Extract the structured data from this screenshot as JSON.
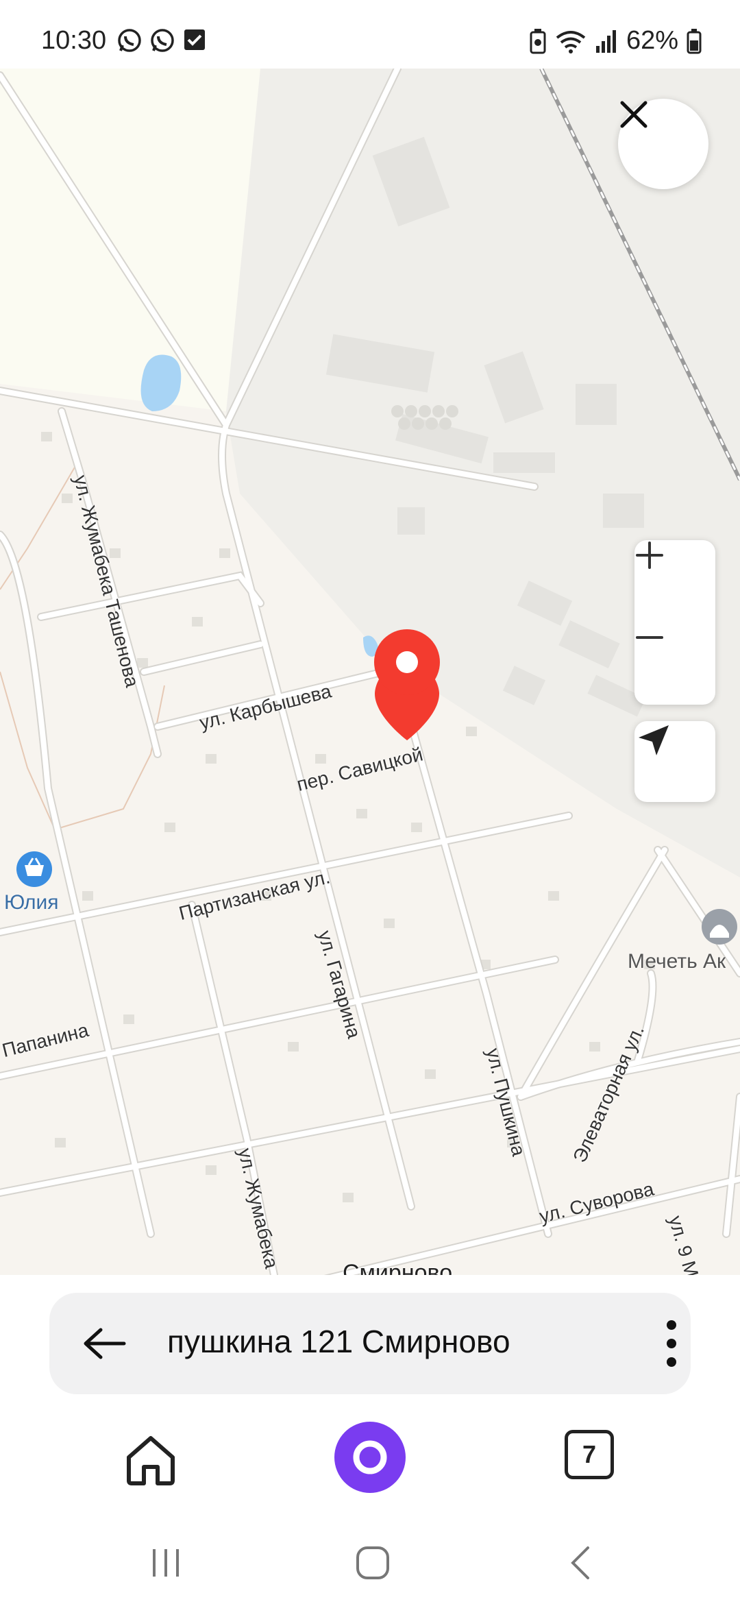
{
  "status_bar": {
    "time": "10:30",
    "battery": "62%",
    "left_icons": [
      "whatsapp-icon",
      "whatsapp-icon",
      "check-box-icon"
    ],
    "right_icons": [
      "battery-saver-icon",
      "wifi-icon",
      "signal-icon",
      "battery-icon"
    ]
  },
  "map": {
    "streets": {
      "zhumabeka_tashenova": "ул. Жумабека Ташенова",
      "karbysheva": "ул. Карбышева",
      "savitskoy": "пер. Савицкой",
      "partizanskaya": "Партизанская ул.",
      "gagarina": "ул. Гагарина",
      "papanina": "Папанина",
      "zhumabeka_lower": "ул. Жумабека",
      "pushkina": "ул. Пушкина",
      "elevatornaya": "Элеваторная ул.",
      "suvorova": "ул. Суворова",
      "ninth_may": "ул. 9 М",
      "town_partial": "Смирново"
    },
    "pois": {
      "shop": "Юлия",
      "mosque": "Мечеть Ак"
    },
    "colors": {
      "marker": "#f33b2f",
      "water": "#a8d4f5",
      "road": "#ffffff",
      "land": "#f7f4ef",
      "poi": "#3a8de0",
      "alice": "#7a3cf0"
    }
  },
  "controls": {
    "close_icon": "close-icon",
    "zoom_in_icon": "plus-icon",
    "zoom_out_icon": "minus-icon",
    "locate_icon": "navigation-arrow-icon"
  },
  "search": {
    "query": "пушкина 121 Смирново",
    "back_icon": "arrow-left-icon",
    "more_icon": "more-vertical-icon"
  },
  "bottom_nav": {
    "home_icon": "home-icon",
    "alice_icon": "alice-icon",
    "tabs_count": "7"
  },
  "system_nav": [
    "recent-apps-icon",
    "home-circle-icon",
    "back-chevron-icon"
  ]
}
